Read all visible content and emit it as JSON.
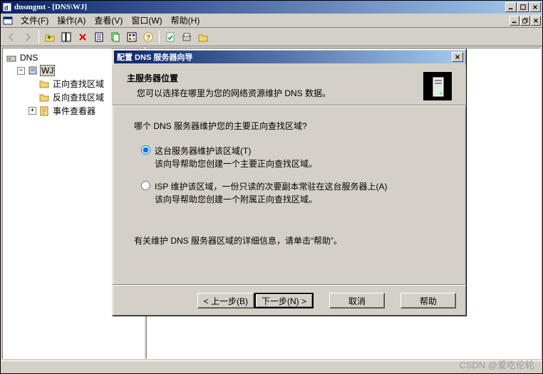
{
  "main_window": {
    "title": "dnsmgmt - [DNS\\WJ]"
  },
  "menu": {
    "file": "文件(F)",
    "action": "操作(A)",
    "view": "查看(V)",
    "window": "窗口(W)",
    "help": "帮助(H)"
  },
  "tree": {
    "root": "DNS",
    "server": "WJ",
    "nodes": {
      "forward": "正向查找区域",
      "reverse": "反向查找区域",
      "events": "事件查看器"
    }
  },
  "dialog": {
    "title": "配置 DNS 服务器向导",
    "header": {
      "title": "主服务器位置",
      "subtitle": "您可以选择在哪里为您的网络资源维护 DNS 数据。"
    },
    "question": "哪个 DNS 服务器维护您的主要正向查找区域?",
    "options": {
      "opt1": {
        "label": "这台服务器维护该区域(T)",
        "sub": "该向导帮助您创建一个主要正向查找区域。"
      },
      "opt2": {
        "label": "ISP 维护该区域，一份只读的次要副本常驻在这台服务器上(A)",
        "sub": "该向导帮助您创建一个附属正向查找区域。"
      }
    },
    "hint": "有关维护 DNS 服务器区域的详细信息，请单击“帮助”。",
    "buttons": {
      "back": "< 上一步(B)",
      "next": "下一步(N) >",
      "cancel": "取消",
      "help": "帮助"
    }
  },
  "watermark": "CSDN @爱吃伦轮"
}
